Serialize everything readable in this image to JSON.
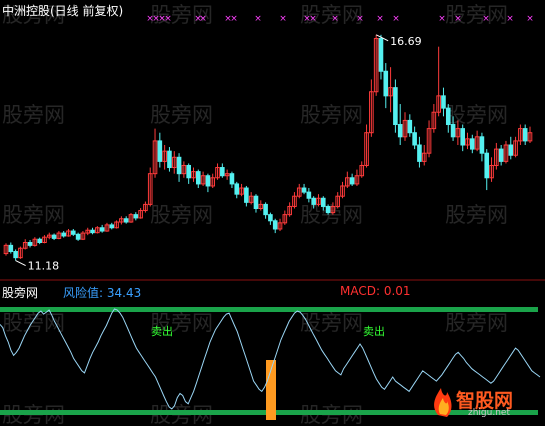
{
  "header": {
    "title": "中洲控股(日线 前复权)"
  },
  "annotations": {
    "high_price": "16.69",
    "low_price": "11.18"
  },
  "lower_panel": {
    "source_label": "股旁网",
    "risk_label": "风险值: 34.43",
    "macd_label": "MACD: 0.01",
    "sell_signals": [
      "卖出",
      "卖出"
    ]
  },
  "watermarks": {
    "text": "股旁网",
    "logo_text": "智股网",
    "logo_sub": "zhigu.net"
  },
  "colors": {
    "up": "#ff3b3b",
    "down": "#55f0f0",
    "title": "#ffffff",
    "risk_label": "#3aa0ff",
    "macd_label": "#ff3030",
    "band": "#1aa34a",
    "risk_line": "#9ad6f5",
    "signal_bar": "#ff9a20",
    "sell_text": "#33ff33",
    "cross": "#ff40ff"
  },
  "chart_data": [
    {
      "type": "candlestick",
      "title": "中洲控股(日线 前复权)",
      "annotations": [
        {
          "label": "16.69",
          "value": 16.69,
          "type": "max"
        },
        {
          "label": "11.18",
          "value": 11.18,
          "type": "min"
        }
      ],
      "ylim": [
        10.9,
        17.1
      ],
      "candles": [
        [
          11.35,
          11.55,
          11.3,
          11.6
        ],
        [
          11.55,
          11.4,
          11.35,
          11.62
        ],
        [
          11.4,
          11.25,
          11.18,
          11.45
        ],
        [
          11.25,
          11.48,
          11.22,
          11.52
        ],
        [
          11.48,
          11.62,
          11.45,
          11.7
        ],
        [
          11.62,
          11.55,
          11.5,
          11.68
        ],
        [
          11.55,
          11.7,
          11.52,
          11.75
        ],
        [
          11.7,
          11.62,
          11.58,
          11.74
        ],
        [
          11.62,
          11.75,
          11.6,
          11.8
        ],
        [
          11.75,
          11.8,
          11.7,
          11.86
        ],
        [
          11.8,
          11.72,
          11.68,
          11.84
        ],
        [
          11.72,
          11.85,
          11.7,
          11.9
        ],
        [
          11.85,
          11.78,
          11.74,
          11.9
        ],
        [
          11.78,
          11.9,
          11.76,
          11.95
        ],
        [
          11.9,
          11.82,
          11.78,
          11.95
        ],
        [
          11.82,
          11.7,
          11.66,
          11.86
        ],
        [
          11.7,
          11.85,
          11.68,
          11.9
        ],
        [
          11.85,
          11.92,
          11.8,
          11.98
        ],
        [
          11.92,
          11.86,
          11.82,
          11.98
        ],
        [
          11.86,
          11.98,
          11.84,
          12.02
        ],
        [
          11.98,
          11.9,
          11.86,
          12.05
        ],
        [
          11.9,
          12.05,
          11.88,
          12.1
        ],
        [
          12.05,
          11.98,
          11.94,
          12.1
        ],
        [
          11.98,
          12.12,
          11.96,
          12.16
        ],
        [
          12.12,
          12.2,
          12.06,
          12.26
        ],
        [
          12.2,
          12.12,
          12.08,
          12.26
        ],
        [
          12.12,
          12.3,
          12.1,
          12.34
        ],
        [
          12.3,
          12.22,
          12.16,
          12.36
        ],
        [
          12.22,
          12.4,
          12.2,
          12.46
        ],
        [
          12.4,
          12.55,
          12.35,
          12.62
        ],
        [
          12.55,
          13.3,
          12.5,
          13.45
        ],
        [
          13.3,
          14.1,
          13.2,
          14.4
        ],
        [
          14.1,
          13.6,
          13.45,
          14.3
        ],
        [
          13.6,
          13.85,
          13.4,
          14.0
        ],
        [
          13.85,
          13.45,
          13.35,
          13.95
        ],
        [
          13.45,
          13.7,
          13.3,
          13.85
        ],
        [
          13.7,
          13.3,
          13.1,
          13.8
        ],
        [
          13.3,
          13.5,
          13.2,
          13.6
        ],
        [
          13.5,
          13.2,
          13.05,
          13.55
        ],
        [
          13.2,
          13.35,
          13.1,
          13.45
        ],
        [
          13.35,
          13.05,
          12.95,
          13.4
        ],
        [
          13.05,
          13.25,
          13.0,
          13.35
        ],
        [
          13.25,
          13.0,
          12.85,
          13.3
        ],
        [
          13.0,
          13.2,
          12.95,
          13.3
        ],
        [
          13.2,
          13.45,
          13.15,
          13.55
        ],
        [
          13.45,
          13.25,
          13.2,
          13.55
        ],
        [
          13.25,
          13.3,
          13.15,
          13.4
        ],
        [
          13.3,
          13.05,
          12.95,
          13.35
        ],
        [
          13.05,
          12.8,
          12.7,
          13.1
        ],
        [
          12.8,
          12.95,
          12.75,
          13.05
        ],
        [
          12.95,
          12.6,
          12.5,
          13.0
        ],
        [
          12.6,
          12.75,
          12.55,
          12.85
        ],
        [
          12.75,
          12.45,
          12.35,
          12.8
        ],
        [
          12.45,
          12.55,
          12.4,
          12.65
        ],
        [
          12.55,
          12.3,
          12.2,
          12.6
        ],
        [
          12.3,
          12.15,
          12.05,
          12.35
        ],
        [
          12.15,
          11.95,
          11.85,
          12.2
        ],
        [
          11.95,
          12.1,
          11.9,
          12.2
        ],
        [
          12.1,
          12.3,
          12.05,
          12.4
        ],
        [
          12.3,
          12.5,
          12.25,
          12.6
        ],
        [
          12.5,
          12.75,
          12.45,
          12.85
        ],
        [
          12.75,
          12.95,
          12.7,
          13.05
        ],
        [
          12.95,
          12.85,
          12.8,
          13.05
        ],
        [
          12.85,
          12.7,
          12.6,
          12.95
        ],
        [
          12.7,
          12.55,
          12.45,
          12.75
        ],
        [
          12.55,
          12.7,
          12.5,
          12.8
        ],
        [
          12.7,
          12.5,
          12.4,
          12.75
        ],
        [
          12.5,
          12.35,
          12.3,
          12.55
        ],
        [
          12.35,
          12.5,
          12.3,
          12.6
        ],
        [
          12.5,
          12.75,
          12.45,
          12.85
        ],
        [
          12.75,
          13.0,
          12.7,
          13.1
        ],
        [
          13.0,
          13.2,
          12.95,
          13.35
        ],
        [
          13.2,
          13.05,
          13.0,
          13.3
        ],
        [
          13.05,
          13.25,
          13.0,
          13.4
        ],
        [
          13.25,
          13.5,
          13.2,
          13.6
        ],
        [
          13.5,
          14.3,
          13.45,
          14.5
        ],
        [
          14.3,
          15.3,
          14.2,
          15.6
        ],
        [
          15.3,
          16.6,
          15.2,
          16.69
        ],
        [
          16.6,
          15.8,
          15.6,
          16.69
        ],
        [
          15.8,
          15.2,
          14.9,
          16.0
        ],
        [
          15.2,
          15.4,
          14.8,
          15.9
        ],
        [
          15.4,
          14.5,
          14.3,
          15.6
        ],
        [
          14.5,
          14.2,
          14.0,
          15.0
        ],
        [
          14.2,
          14.6,
          14.1,
          14.8
        ],
        [
          14.6,
          14.3,
          14.2,
          14.75
        ],
        [
          14.3,
          14.0,
          13.9,
          14.45
        ],
        [
          14.0,
          13.6,
          13.45,
          14.2
        ],
        [
          13.6,
          13.8,
          13.5,
          14.0
        ],
        [
          13.8,
          14.4,
          13.7,
          14.6
        ],
        [
          14.4,
          14.8,
          14.3,
          15.0
        ],
        [
          14.8,
          15.2,
          14.7,
          16.4
        ],
        [
          15.2,
          14.9,
          14.7,
          15.4
        ],
        [
          14.9,
          14.5,
          14.3,
          15.0
        ],
        [
          14.5,
          14.2,
          14.1,
          14.7
        ],
        [
          14.2,
          14.4,
          14.0,
          14.6
        ],
        [
          14.4,
          14.0,
          13.85,
          14.5
        ],
        [
          14.0,
          14.15,
          13.9,
          14.3
        ],
        [
          14.15,
          13.9,
          13.8,
          14.25
        ],
        [
          13.9,
          14.2,
          13.85,
          14.35
        ],
        [
          14.2,
          13.8,
          13.6,
          14.3
        ],
        [
          13.8,
          13.2,
          12.9,
          13.9
        ],
        [
          13.2,
          13.5,
          13.1,
          13.7
        ],
        [
          13.5,
          13.9,
          13.4,
          14.05
        ],
        [
          13.9,
          13.6,
          13.5,
          14.0
        ],
        [
          13.6,
          14.0,
          13.55,
          14.1
        ],
        [
          14.0,
          13.75,
          13.65,
          14.2
        ],
        [
          13.75,
          14.1,
          13.7,
          14.2
        ],
        [
          14.1,
          14.4,
          14.0,
          14.5
        ],
        [
          14.4,
          14.1,
          14.0,
          14.5
        ],
        [
          14.1,
          14.3,
          14.05,
          14.45
        ]
      ]
    },
    {
      "type": "line",
      "title": "风险值: 34.43",
      "ylim": [
        0,
        100
      ],
      "series": [
        {
          "values": [
            85,
            82,
            74,
            68,
            60,
            55,
            58,
            62,
            68,
            74,
            79,
            84,
            88,
            92,
            96,
            98,
            95,
            97,
            99,
            94,
            88,
            83,
            78,
            73,
            68,
            63,
            58,
            52,
            48,
            44,
            40,
            38,
            45,
            52,
            58,
            63,
            68,
            74,
            79,
            84,
            90,
            96,
            100,
            99,
            96,
            92,
            86,
            80,
            74,
            68,
            62,
            58,
            54,
            50,
            46,
            42,
            38,
            34,
            28,
            22,
            16,
            10,
            5,
            3,
            6,
            14,
            18,
            16,
            10,
            8,
            14,
            20,
            28,
            36,
            44,
            52,
            60,
            68,
            74,
            80,
            84,
            88,
            92,
            95,
            96,
            90,
            84,
            78,
            70,
            62,
            54,
            46,
            38,
            30,
            26,
            22,
            20,
            24,
            30,
            38,
            46,
            54,
            62,
            70,
            76,
            82,
            88,
            92,
            96,
            98,
            97,
            94,
            90,
            85,
            80,
            75,
            70,
            65,
            60,
            56,
            52,
            48,
            44,
            40,
            38,
            36,
            42,
            46,
            50,
            54,
            58,
            62,
            66,
            62,
            56,
            50,
            44,
            38,
            32,
            28,
            24,
            22,
            26,
            30,
            34,
            30,
            28,
            26,
            24,
            22,
            20,
            24,
            28,
            32,
            36,
            40,
            38,
            36,
            34,
            32,
            30,
            33,
            36,
            40,
            44,
            48,
            52,
            56,
            58,
            55,
            52,
            48,
            45,
            42,
            40,
            38,
            36,
            34,
            32,
            30,
            28,
            30,
            34,
            38,
            42,
            46,
            50,
            54,
            58,
            62,
            60,
            56,
            52,
            48,
            44,
            40,
            38,
            36,
            34
          ]
        }
      ]
    }
  ]
}
